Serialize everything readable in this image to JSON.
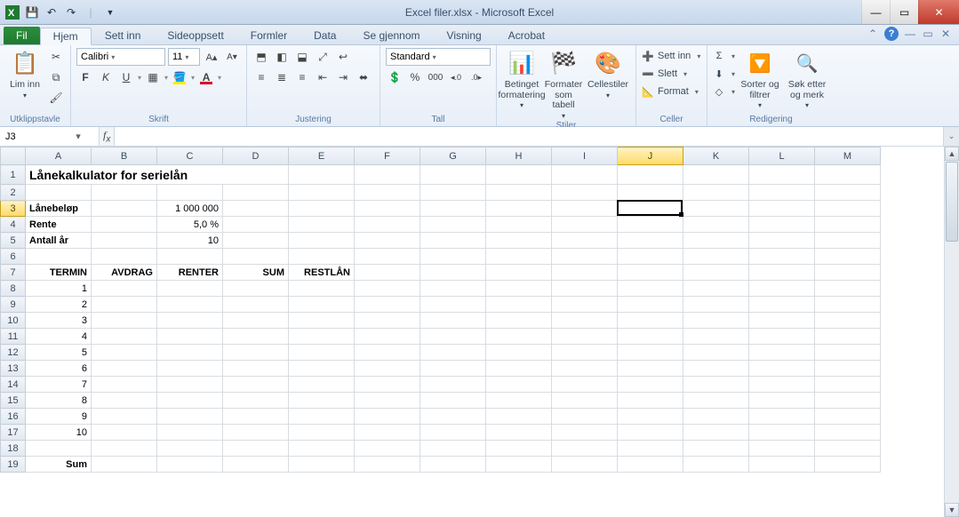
{
  "title": "Excel filer.xlsx - Microsoft Excel",
  "tabs": {
    "file": "Fil",
    "items": [
      "Hjem",
      "Sett inn",
      "Sideoppsett",
      "Formler",
      "Data",
      "Se gjennom",
      "Visning",
      "Acrobat"
    ],
    "active": 0
  },
  "ribbon": {
    "clipboard": {
      "label": "Utklippstavle",
      "paste": "Lim inn"
    },
    "font": {
      "label": "Skrift",
      "name": "Calibri",
      "size": "11"
    },
    "alignment": {
      "label": "Justering"
    },
    "number": {
      "label": "Tall",
      "format": "Standard"
    },
    "styles": {
      "label": "Stiler",
      "conditional": "Betinget formatering",
      "table": "Formater som tabell",
      "cell": "Cellestiler"
    },
    "cells": {
      "label": "Celler",
      "insert": "Sett inn",
      "delete": "Slett",
      "format": "Format"
    },
    "editing": {
      "label": "Redigering",
      "sort": "Sorter og filtrer",
      "find": "Søk etter og merk"
    }
  },
  "namebox": "J3",
  "formula": "",
  "columns": [
    "A",
    "B",
    "C",
    "D",
    "E",
    "F",
    "G",
    "H",
    "I",
    "J",
    "K",
    "L",
    "M"
  ],
  "rows": [
    1,
    2,
    3,
    4,
    5,
    6,
    7,
    8,
    9,
    10,
    11,
    12,
    13,
    14,
    15,
    16,
    17,
    18,
    19
  ],
  "active": {
    "col": "J",
    "row": 3
  },
  "cells": {
    "A1": {
      "v": "Lånekalkulator for serielån",
      "cls": "big left",
      "span": 4
    },
    "A3": {
      "v": "Lånebeløp",
      "cls": "bold left"
    },
    "C3": {
      "v": "1 000 000",
      "cls": "right"
    },
    "A4": {
      "v": "Rente",
      "cls": "bold left"
    },
    "C4": {
      "v": "5,0 %",
      "cls": "right"
    },
    "A5": {
      "v": "Antall år",
      "cls": "bold left"
    },
    "C5": {
      "v": "10",
      "cls": "right"
    },
    "A7": {
      "v": "TERMIN",
      "cls": "bold right"
    },
    "B7": {
      "v": "AVDRAG",
      "cls": "bold right"
    },
    "C7": {
      "v": "RENTER",
      "cls": "bold right"
    },
    "D7": {
      "v": "SUM",
      "cls": "bold right"
    },
    "E7": {
      "v": "RESTLÅN",
      "cls": "bold right"
    },
    "A8": {
      "v": "1",
      "cls": "right"
    },
    "A9": {
      "v": "2",
      "cls": "right"
    },
    "A10": {
      "v": "3",
      "cls": "right"
    },
    "A11": {
      "v": "4",
      "cls": "right"
    },
    "A12": {
      "v": "5",
      "cls": "right"
    },
    "A13": {
      "v": "6",
      "cls": "right"
    },
    "A14": {
      "v": "7",
      "cls": "right"
    },
    "A15": {
      "v": "8",
      "cls": "right"
    },
    "A16": {
      "v": "9",
      "cls": "right"
    },
    "A17": {
      "v": "10",
      "cls": "right"
    },
    "A19": {
      "v": "Sum",
      "cls": "bold right"
    }
  }
}
